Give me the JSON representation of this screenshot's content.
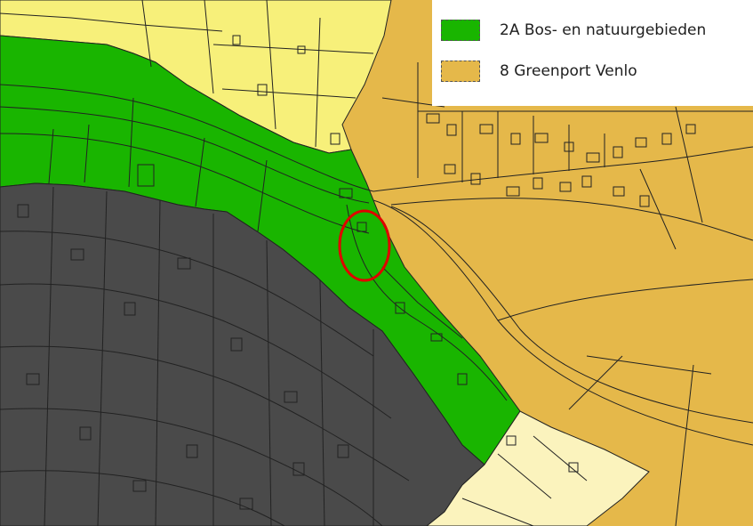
{
  "legend": {
    "items": [
      {
        "code": "2A",
        "label": "2A  Bos- en natuurgebieden",
        "color": "#19b500"
      },
      {
        "code": "8",
        "label": "8  Greenport Venlo",
        "color": "#e5b84a"
      }
    ]
  },
  "map": {
    "zones": [
      {
        "name": "bos-en-natuurgebieden",
        "color": "#19b500"
      },
      {
        "name": "greenport-venlo",
        "color": "#e5b84a"
      },
      {
        "name": "urban-built-area",
        "color": "#4a4a4a"
      },
      {
        "name": "residential-light-yellow-north",
        "color": "#f7f07a"
      },
      {
        "name": "residential-cream-south",
        "color": "#fbf3bd"
      }
    ],
    "marker": {
      "shape": "ellipse",
      "color": "#e00000"
    }
  }
}
